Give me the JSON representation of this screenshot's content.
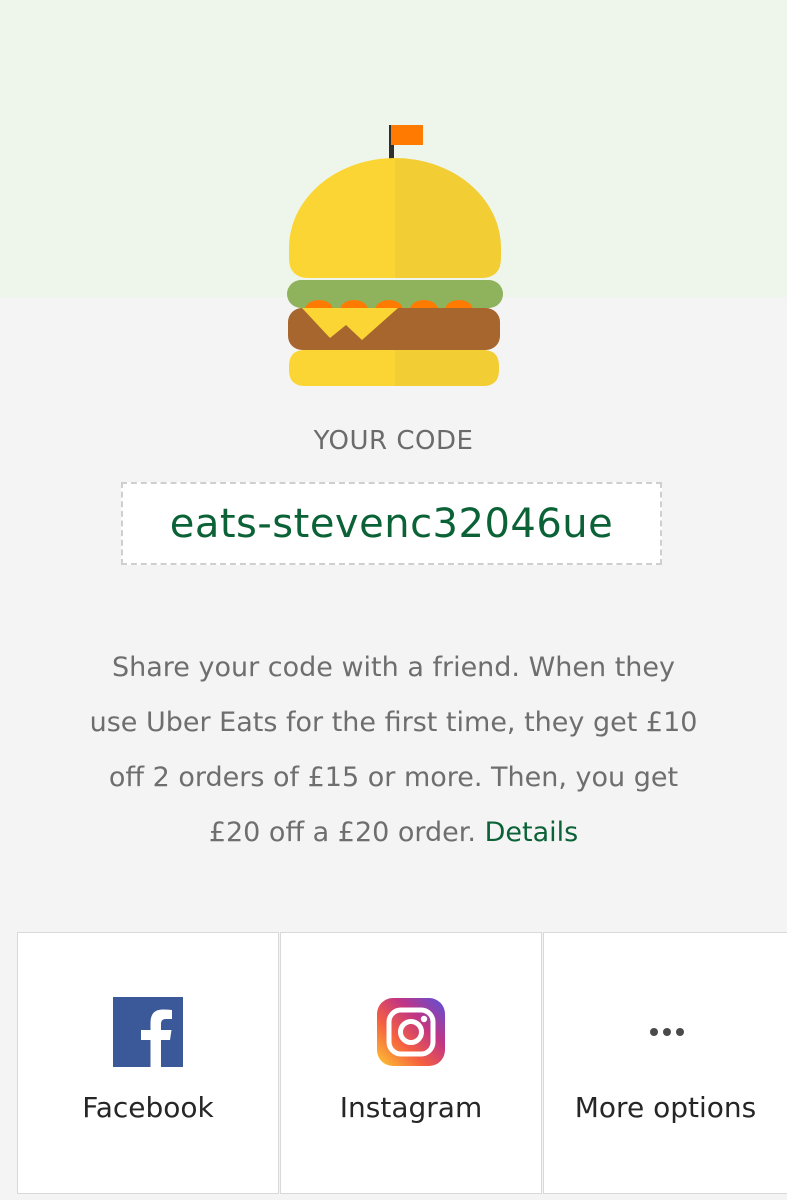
{
  "code_section": {
    "label": "YOUR CODE",
    "code": "eats-stevenc32046ue"
  },
  "description": {
    "line1": "Share your code with a friend. When they",
    "line2": "use Uber Eats for the first time, they get £10",
    "line3": "off 2 orders of £15 or more. Then, you get",
    "line4": "£20 off a £20 order.",
    "details_link": "Details"
  },
  "share_options": [
    {
      "label": "Facebook",
      "icon": "facebook-icon"
    },
    {
      "label": "Instagram",
      "icon": "instagram-icon"
    },
    {
      "label": "More options",
      "icon": "more-icon"
    }
  ],
  "colors": {
    "accent_green": "#0a6236",
    "hero_background": "#eef6ec",
    "page_background": "#f4f4f4",
    "facebook_blue": "#3b5998"
  }
}
